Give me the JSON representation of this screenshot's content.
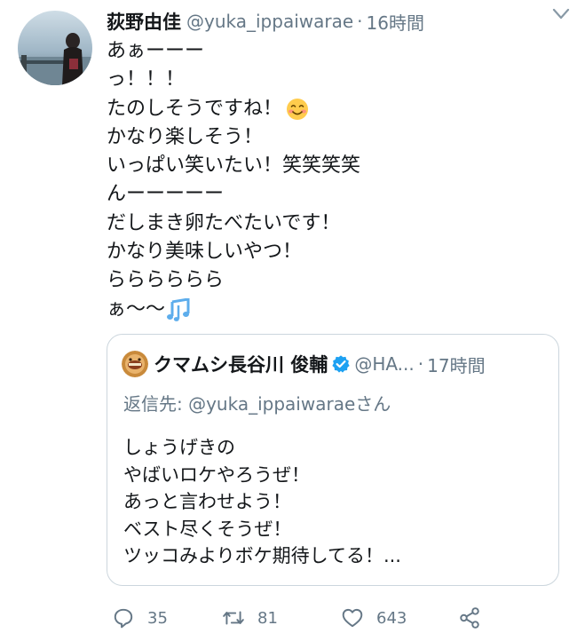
{
  "tweet": {
    "display_name": "荻野由佳",
    "handle": "@yuka_ippaiwarae",
    "separator": "·",
    "time": "16時間",
    "lines": [
      "あぁーーー",
      "っ！！！",
      "たのしそうですね！",
      "かなり楽しそう！",
      "いっぱい笑いたい！笑笑笑笑",
      "んーーーーー",
      "だしまき卵たべたいです！",
      "かなり美味しいやつ！",
      "らららららら",
      "ぁ〜〜"
    ]
  },
  "quoted": {
    "display_name": "クマムシ長谷川 俊輔",
    "handle": "@HA...",
    "separator": "·",
    "time": "17時間",
    "reply_to": "返信先: @yuka_ippaiwaraeさん",
    "lines": [
      "しょうげきの",
      "やばいロケやろうぜ！",
      "あっと言わせよう！",
      "ベスト尽くそうぜ！",
      "ツッコみよりボケ期待してる！..."
    ]
  },
  "actions": {
    "reply_count": "35",
    "retweet_count": "81",
    "like_count": "643"
  },
  "icons": {
    "reply": "reply-icon",
    "retweet": "retweet-icon",
    "like": "heart-icon",
    "share": "share-icon",
    "verified": "verified-icon",
    "caret": "chevron-down-icon"
  },
  "colors": {
    "text": "#14171a",
    "secondary": "#657786",
    "verified": "#1da1f2",
    "border": "#ccd6dd"
  }
}
